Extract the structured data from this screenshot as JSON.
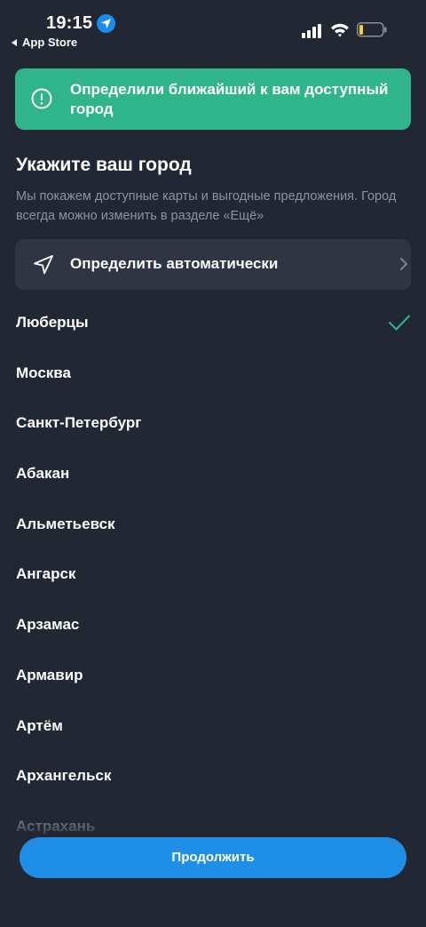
{
  "status_bar": {
    "time": "19:15",
    "back_app": "App Store"
  },
  "toast": {
    "message": "Определили ближайший к вам доступный город",
    "icon": "info-icon",
    "color": "#30b48a"
  },
  "header": {
    "title": "Укажите ваш город",
    "subtitle": "Мы покажем доступные карты и выгодные предложения. Город всегда можно изменить в разделе «Ещё»"
  },
  "auto_detect": {
    "label": "Определить автоматически",
    "icon": "navigation-arrow-icon"
  },
  "cities": [
    {
      "name": "Люберцы",
      "selected": true
    },
    {
      "name": "Москва",
      "selected": false
    },
    {
      "name": "Санкт-Петербург",
      "selected": false
    },
    {
      "name": "Абакан",
      "selected": false
    },
    {
      "name": "Альметьевск",
      "selected": false
    },
    {
      "name": "Ангарск",
      "selected": false
    },
    {
      "name": "Арзамас",
      "selected": false
    },
    {
      "name": "Армавир",
      "selected": false
    },
    {
      "name": "Артём",
      "selected": false
    },
    {
      "name": "Архангельск",
      "selected": false
    },
    {
      "name": "Астрахань",
      "selected": false
    }
  ],
  "continue_button": {
    "label": "Продолжить",
    "color": "#1f8ee6"
  },
  "colors": {
    "background": "#222833",
    "accent_green": "#30b48a",
    "muted_text": "#8b93a1"
  }
}
